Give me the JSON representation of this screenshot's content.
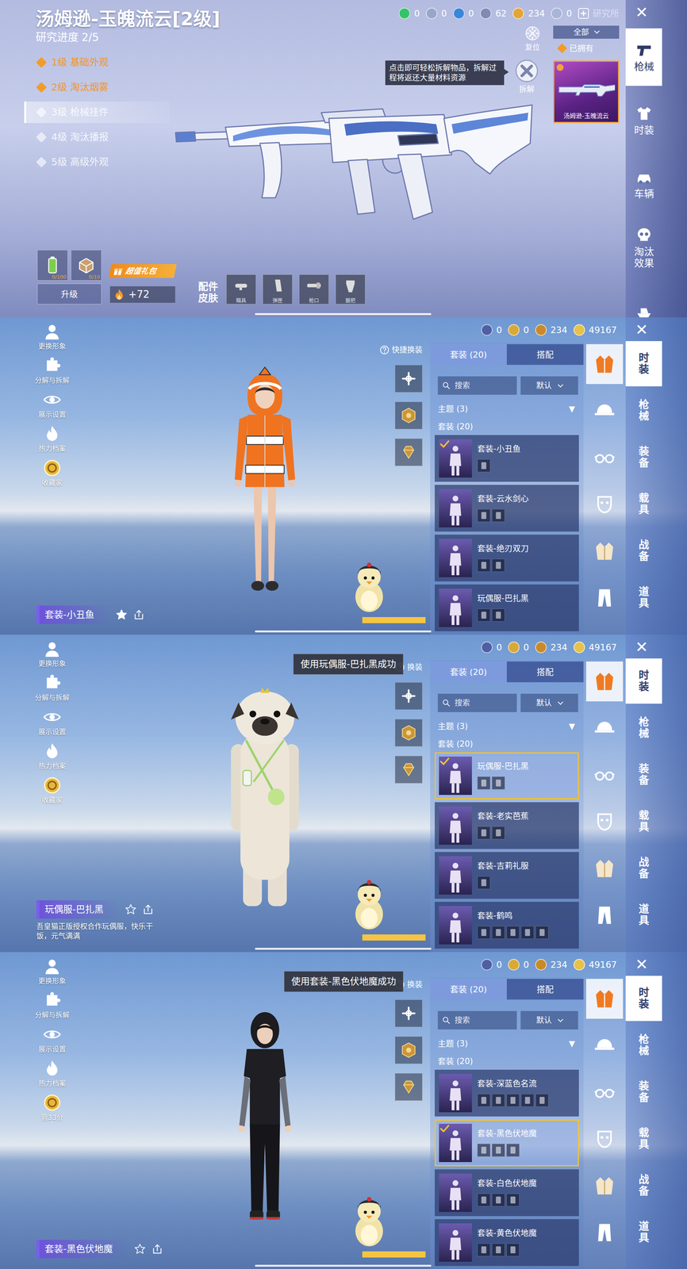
{
  "weapon_screen": {
    "title": "汤姆逊-玉魄流云[2级]",
    "progress_label": "研究进度",
    "progress": "2/5",
    "levels": [
      {
        "label": "1级 基础外观",
        "unlocked": true,
        "selected": false
      },
      {
        "label": "2级 淘汰烟雾",
        "unlocked": true,
        "selected": false
      },
      {
        "label": "3级 枪械挂件",
        "unlocked": false,
        "selected": true
      },
      {
        "label": "4级 淘汰播报",
        "unlocked": false,
        "selected": false
      },
      {
        "label": "5级 高级外观",
        "unlocked": false,
        "selected": false
      }
    ],
    "currencies": [
      "0",
      "0",
      "0",
      "62",
      "234",
      "0"
    ],
    "lab": "研究所",
    "close": "✕",
    "reset": "复位",
    "filter": "全部",
    "owned": {
      "label": "已拥有",
      "checked": true
    },
    "tooltip": "点击即可轻松拆解物品，拆解过程将返还大量材料资源",
    "dismantle": "拆解",
    "item": {
      "name": "汤姆逊-玉魄流云",
      "selected": true
    },
    "materials": [
      "0/100",
      "0/10"
    ],
    "upgrade": "升级",
    "gift": "超值礼包",
    "heat": "+72",
    "attachments_label": "配件皮肤",
    "attachments": [
      "瞄具",
      "弹匣",
      "枪口",
      "握把"
    ],
    "nav": [
      {
        "label": "枪械",
        "selected": true
      },
      {
        "label": "时装",
        "selected": false
      },
      {
        "label": "车辆",
        "selected": false
      },
      {
        "label": "淘汰效果",
        "selected": false
      }
    ]
  },
  "wardrobe_screens": [
    {
      "currencies": [
        "0",
        "0",
        "234",
        "49167"
      ],
      "close": "✕",
      "actions": [
        "更换形象",
        "分解与拆解",
        "展示设置",
        "热力档案",
        "收藏家"
      ],
      "quick_change": "快捷换装",
      "tabs": [
        {
          "label": "套装 (20)",
          "selected": true
        },
        {
          "label": "搭配",
          "selected": false
        }
      ],
      "search": {
        "placeholder": "搜索"
      },
      "sort": "默认",
      "theme": "主题 (3)",
      "theme_arrow": "▼",
      "section": "套装 (20)",
      "outfits": [
        {
          "name": "套装-小丑鱼",
          "equipped": true,
          "selected": false,
          "pieces": 1
        },
        {
          "name": "套装-云水剑心",
          "equipped": false,
          "selected": false,
          "pieces": 2
        },
        {
          "name": "套装-绝刃双刀",
          "equipped": false,
          "selected": false,
          "pieces": 2
        },
        {
          "name": "玩偶服-巴扎黑",
          "equipped": false,
          "selected": false,
          "pieces": 2
        }
      ],
      "categories": [
        {
          "selected": true
        },
        {
          "selected": false
        },
        {
          "selected": false
        },
        {
          "selected": false
        },
        {
          "selected": false
        },
        {
          "selected": false
        }
      ],
      "nav": [
        {
          "label": "时装",
          "selected": true
        },
        {
          "label": "枪械",
          "selected": false
        },
        {
          "label": "装备",
          "selected": false
        },
        {
          "label": "载具",
          "selected": false
        },
        {
          "label": "战备",
          "selected": false
        },
        {
          "label": "道具",
          "selected": false
        }
      ],
      "character": {
        "kind": "clownfish",
        "name": "套装-小丑鱼",
        "favorite": true
      }
    },
    {
      "currencies": [
        "0",
        "0",
        "234",
        "49167"
      ],
      "close": "✕",
      "actions": [
        "更换形象",
        "分解与拆解",
        "展示设置",
        "热力档案",
        "收藏家"
      ],
      "quick_change": "换装",
      "toast": "使用玩偶服-巴扎黑成功",
      "tabs": [
        {
          "label": "套装 (20)",
          "selected": true
        },
        {
          "label": "搭配",
          "selected": false
        }
      ],
      "search": {
        "placeholder": "搜索"
      },
      "sort": "默认",
      "theme": "主题 (3)",
      "theme_arrow": "▼",
      "section": "套装 (20)",
      "outfits": [
        {
          "name": "玩偶服-巴扎黑",
          "equipped": true,
          "selected": true,
          "pieces": 2
        },
        {
          "name": "套装-老实芭蕉",
          "equipped": false,
          "selected": false,
          "pieces": 2
        },
        {
          "name": "套装-吉莉礼服",
          "equipped": false,
          "selected": false,
          "pieces": 1
        },
        {
          "name": "套装-鹤鸣",
          "equipped": false,
          "selected": false,
          "pieces": 5
        }
      ],
      "categories": [
        {
          "selected": true
        },
        {
          "selected": false
        },
        {
          "selected": false
        },
        {
          "selected": false
        },
        {
          "selected": false
        },
        {
          "selected": false
        }
      ],
      "nav": [
        {
          "label": "时装",
          "selected": true
        },
        {
          "label": "枪械",
          "selected": false
        },
        {
          "label": "装备",
          "selected": false
        },
        {
          "label": "载具",
          "selected": false
        },
        {
          "label": "战备",
          "selected": false
        },
        {
          "label": "道具",
          "selected": false
        }
      ],
      "character": {
        "kind": "pug",
        "name": "玩偶服-巴扎黑",
        "favorite": false,
        "description": "吾皇猫正版授权合作玩偶服，快乐干饭，元气满满"
      }
    },
    {
      "currencies": [
        "0",
        "0",
        "234",
        "49167"
      ],
      "close": "✕",
      "actions": [
        "更换形象",
        "分解与拆解",
        "展示设置",
        "热力档案",
        "管33分"
      ],
      "quick_change": "换装",
      "toast": "使用套装-黑色伏地魔成功",
      "tabs": [
        {
          "label": "套装 (20)",
          "selected": true
        },
        {
          "label": "搭配",
          "selected": false
        }
      ],
      "search": {
        "placeholder": "搜索"
      },
      "sort": "默认",
      "theme": "主题 (3)",
      "theme_arrow": "▼",
      "section": "套装 (20)",
      "outfits": [
        {
          "name": "套装-深蓝色名流",
          "equipped": false,
          "selected": false,
          "pieces": 5
        },
        {
          "name": "套装-黑色伏地魔",
          "equipped": true,
          "selected": true,
          "pieces": 3
        },
        {
          "name": "套装-白色伏地魔",
          "equipped": false,
          "selected": false,
          "pieces": 3
        },
        {
          "name": "套装-黄色伏地魔",
          "equipped": false,
          "selected": false,
          "pieces": 3
        }
      ],
      "categories": [
        {
          "selected": true
        },
        {
          "selected": false
        },
        {
          "selected": false
        },
        {
          "selected": false
        },
        {
          "selected": false
        },
        {
          "selected": false
        }
      ],
      "nav": [
        {
          "label": "时装",
          "selected": true
        },
        {
          "label": "枪械",
          "selected": false
        },
        {
          "label": "装备",
          "selected": false
        },
        {
          "label": "载具",
          "selected": false
        },
        {
          "label": "战备",
          "selected": false
        },
        {
          "label": "道具",
          "selected": false
        }
      ],
      "character": {
        "kind": "hoodie",
        "name": "套装-黑色伏地魔",
        "favorite": false
      }
    }
  ]
}
